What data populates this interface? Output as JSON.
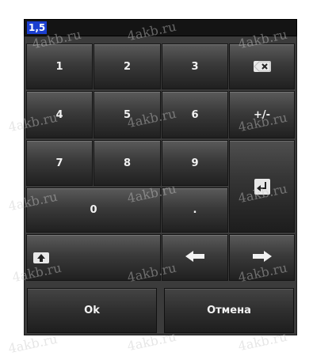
{
  "display": {
    "value": "1,5"
  },
  "keys": {
    "k1": "1",
    "k2": "2",
    "k3": "3",
    "k4": "4",
    "k5": "5",
    "k6": "6",
    "sign": "+/-",
    "k7": "7",
    "k8": "8",
    "k9": "9",
    "k0": "0",
    "decimal": "."
  },
  "buttons": {
    "ok": "Ok",
    "cancel": "Отмена"
  },
  "icons": {
    "backspace": "backspace-icon",
    "enter": "enter-icon",
    "shift": "shift-up-icon",
    "left": "arrow-left-icon",
    "right": "arrow-right-icon"
  },
  "watermark": {
    "text": "4akb.ru"
  }
}
